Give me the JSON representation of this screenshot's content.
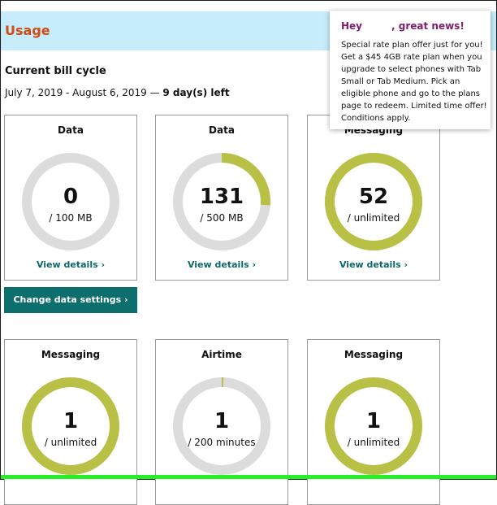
{
  "header": {
    "title": "Usage"
  },
  "bill_cycle": {
    "title": "Current bill cycle",
    "dates": "July 7, 2019 - August 6, 2019 — ",
    "days_left": "9 day(s) left"
  },
  "cards": [
    {
      "label": "Data",
      "value": "0",
      "unit": "/ 100 MB",
      "fraction": 0,
      "link": "View details ›"
    },
    {
      "label": "Data",
      "value": "131",
      "unit": "/ 500 MB",
      "fraction": 0.262,
      "link": "View details ›"
    },
    {
      "label": "Messaging",
      "value": "52",
      "unit": "/ unlimited",
      "fraction": 1,
      "link": "View details ›"
    },
    {
      "label": "Messaging",
      "value": "1",
      "unit": "/ unlimited",
      "fraction": 1,
      "link": ""
    },
    {
      "label": "Airtime",
      "value": "1",
      "unit": "/ 200 minutes",
      "fraction": 0.005,
      "link": ""
    },
    {
      "label": "Messaging",
      "value": "1",
      "unit": "/ unlimited",
      "fraction": 1,
      "link": ""
    }
  ],
  "change_data_button": "Change data settings ›",
  "promo": {
    "greeting": "Hey",
    "headline": ", great news!",
    "body": "Special rate plan offer just for you! Get a $45 4GB rate plan when you upgrade to select phones with Tab Small or Tab Medium. Pick an eligible phone and go to the plans page to redeem. Limited time offer! Conditions apply."
  },
  "colors": {
    "accent_orange": "#d34a12",
    "header_bg": "#c7ecfb",
    "ring_fill": "#b9c046",
    "ring_track": "#dcdcdc",
    "teal": "#0d6e6e",
    "promo_purple": "#7e1d6b"
  }
}
